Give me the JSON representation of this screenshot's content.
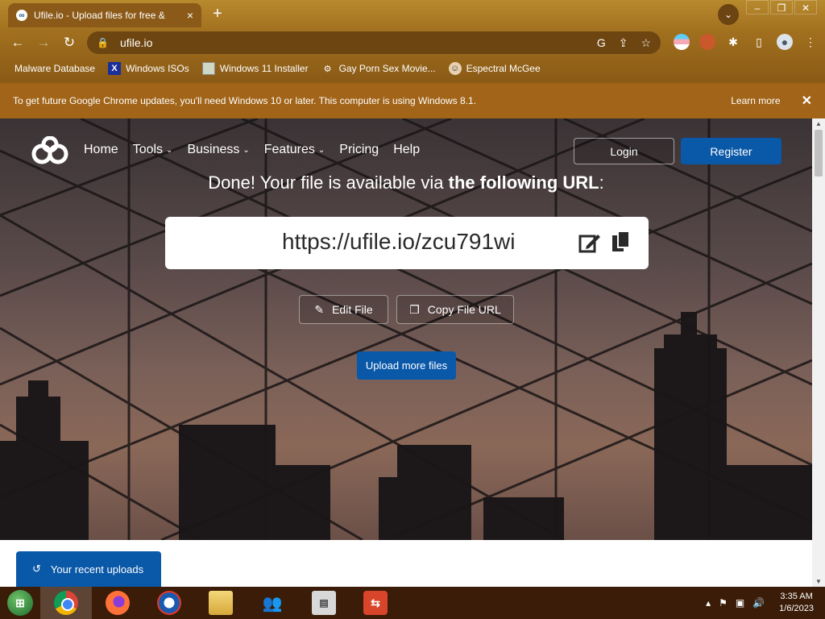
{
  "browser": {
    "tab_title": "Ufile.io - Upload files for free &",
    "tab_close": "×",
    "new_tab": "+",
    "url": "ufile.io",
    "window_controls": {
      "minimize": "–",
      "restore": "❐",
      "close": "✕"
    }
  },
  "bookmarks": [
    {
      "label": "Malware Database"
    },
    {
      "label": "Windows ISOs",
      "icon": "X"
    },
    {
      "label": "Windows 11 Installer"
    },
    {
      "label": "Gay Porn Sex Movie..."
    },
    {
      "label": "Espectral McGee"
    }
  ],
  "infobar": {
    "message": "To get future Google Chrome updates, you'll need Windows 10 or later. This computer is using Windows 8.1.",
    "learn_more": "Learn more",
    "close": "✕"
  },
  "site": {
    "nav": {
      "home": "Home",
      "tools": "Tools",
      "business": "Business",
      "features": "Features",
      "pricing": "Pricing",
      "help": "Help",
      "chevron": "⌄"
    },
    "login": "Login",
    "register": "Register",
    "done_prefix": "Done! Your file is available via ",
    "done_bold": "the following URL",
    "done_suffix": ":",
    "file_url": "https://ufile.io/zcu791wi",
    "edit_file": "Edit File",
    "copy_file_url": "Copy File URL",
    "upload_more": "Upload more files",
    "recent_uploads": "Your recent uploads"
  },
  "taskbar": {
    "time": "3:35 AM",
    "date": "1/6/2023"
  },
  "colors": {
    "accent_blue": "#0a58a8",
    "infobar": "#a16418",
    "taskbar": "#3a1c08"
  }
}
